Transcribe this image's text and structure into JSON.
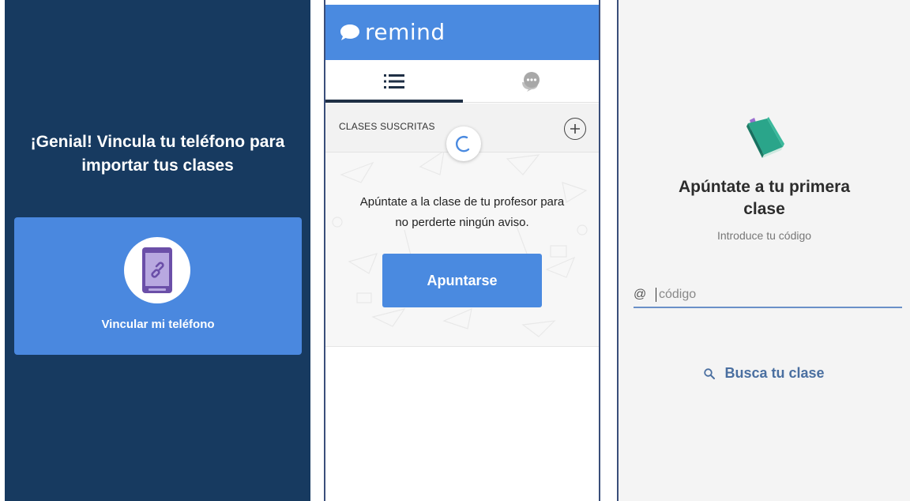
{
  "panel1": {
    "headline": "¡Genial! Vincula tu teléfono para importar tus clases",
    "link_phone_label": "Vincular mi teléfono",
    "bg_color": "#173a60",
    "card_color": "#4a88df",
    "icon": "phone-link-icon"
  },
  "panel2": {
    "brand": "remind",
    "tabs": [
      {
        "icon": "list-icon",
        "active": true
      },
      {
        "icon": "chat-icon",
        "active": false
      }
    ],
    "section_title": "CLASES SUSCRITAS",
    "empty_message": "Apúntate a la clase de tu profesor para no perderte ningún aviso.",
    "join_button": "Apuntarse",
    "accent_color": "#4a8ae0"
  },
  "panel3": {
    "title": "Apúntate a tu primera clase",
    "subtitle": "Introduce tu código",
    "code_prefix": "@",
    "code_placeholder": "código",
    "search_link": "Busca tu clase",
    "icon": "book-icon"
  }
}
